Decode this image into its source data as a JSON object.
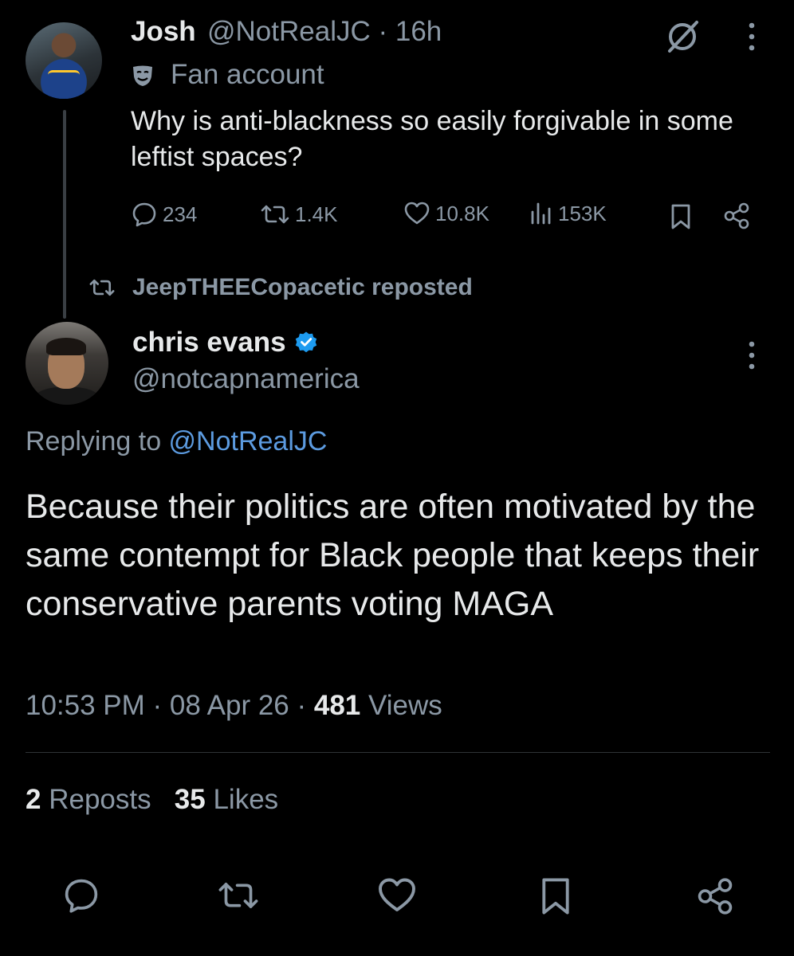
{
  "parent_tweet": {
    "name": "Josh",
    "handle": "@NotRealJC",
    "time_suffix": " · 16h",
    "label": "Fan account",
    "text": "Why is anti-blackness so easily forgivable in some leftist spaces?",
    "stats": {
      "replies": "234",
      "reposts": "1.4K",
      "likes": "10.8K",
      "views": "153K"
    },
    "icons": [
      "grok-icon",
      "more-icon",
      "reply-icon",
      "repost-icon",
      "like-icon",
      "views-icon",
      "bookmark-icon",
      "share-icon",
      "fan-account-mask-icon"
    ]
  },
  "repost_banner": {
    "label": "JeepTHEECopacetic reposted"
  },
  "main_tweet": {
    "name": "chris evans",
    "handle": "@notcapnamerica",
    "verified": true,
    "replying_prefix": "Replying to ",
    "replying_to": "@NotRealJC",
    "text": "Because their politics are often motivated by the same contempt for Black people that keeps their conservative parents voting MAGA",
    "time": "10:53 PM",
    "date": "08 Apr 26",
    "views_count": "481",
    "views_label": "Views",
    "reposts_count": "2",
    "reposts_label": "Reposts",
    "likes_count": "35",
    "likes_label": "Likes"
  },
  "colors": {
    "background": "#000000",
    "text": "#e7e9ea",
    "muted": "#8b98a5",
    "link": "#5c9be0",
    "verified": "#1d9bf0"
  }
}
